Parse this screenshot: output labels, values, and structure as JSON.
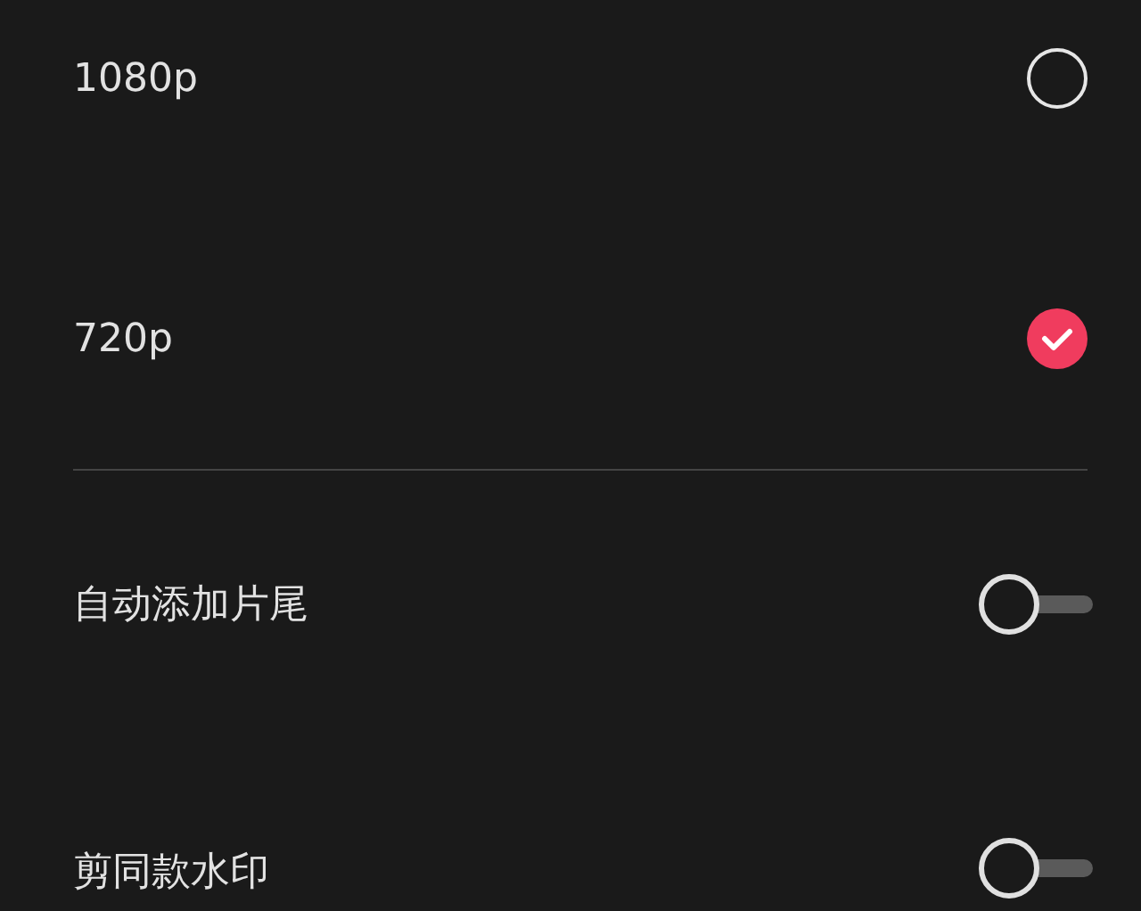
{
  "resolution_options": [
    {
      "label": "1080p",
      "selected": false
    },
    {
      "label": "720p",
      "selected": true
    }
  ],
  "toggles": [
    {
      "label": "自动添加片尾",
      "on": false
    },
    {
      "label": "剪同款水印",
      "on": false
    }
  ]
}
